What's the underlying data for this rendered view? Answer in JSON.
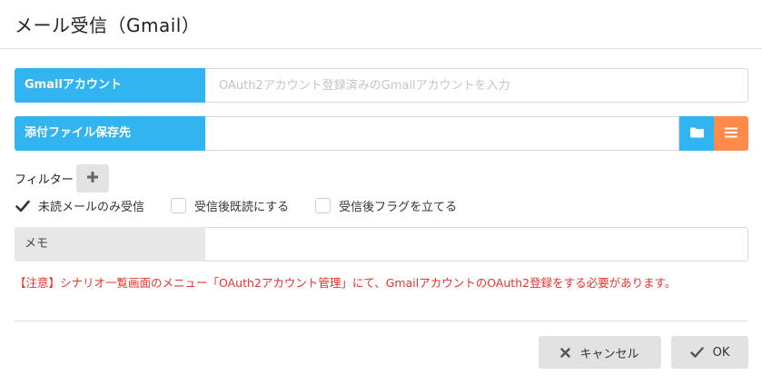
{
  "dialog": {
    "title": "メール受信（Gmail）"
  },
  "fields": {
    "gmail_account": {
      "label": "Gmailアカウント",
      "value": "",
      "placeholder": "OAuth2アカウント登録済みのGmailアカウントを入力"
    },
    "attachment_dest": {
      "label": "添付ファイル保存先",
      "value": "",
      "folder_icon": "folder-icon",
      "list_icon": "list-icon"
    },
    "memo": {
      "label": "メモ",
      "value": ""
    }
  },
  "filter": {
    "label": "フィルター",
    "add_icon": "plus-icon"
  },
  "options": [
    {
      "label": "未読メールのみ受信",
      "checked": true
    },
    {
      "label": "受信後既読にする",
      "checked": false
    },
    {
      "label": "受信後フラグを立てる",
      "checked": false
    }
  ],
  "notice": "【注意】シナリオ一覧画面のメニュー「OAuth2アカウント管理」にて、GmailアカウントのOAuth2登録をする必要があります。",
  "buttons": {
    "cancel": {
      "label": "キャンセル",
      "icon": "close-icon"
    },
    "ok": {
      "label": "OK",
      "icon": "check-icon"
    }
  },
  "colors": {
    "label_blue": "#31b4ef",
    "list_orange": "#ff8a4c",
    "notice_red": "#e8332a",
    "button_gray": "#e2e2e2"
  }
}
